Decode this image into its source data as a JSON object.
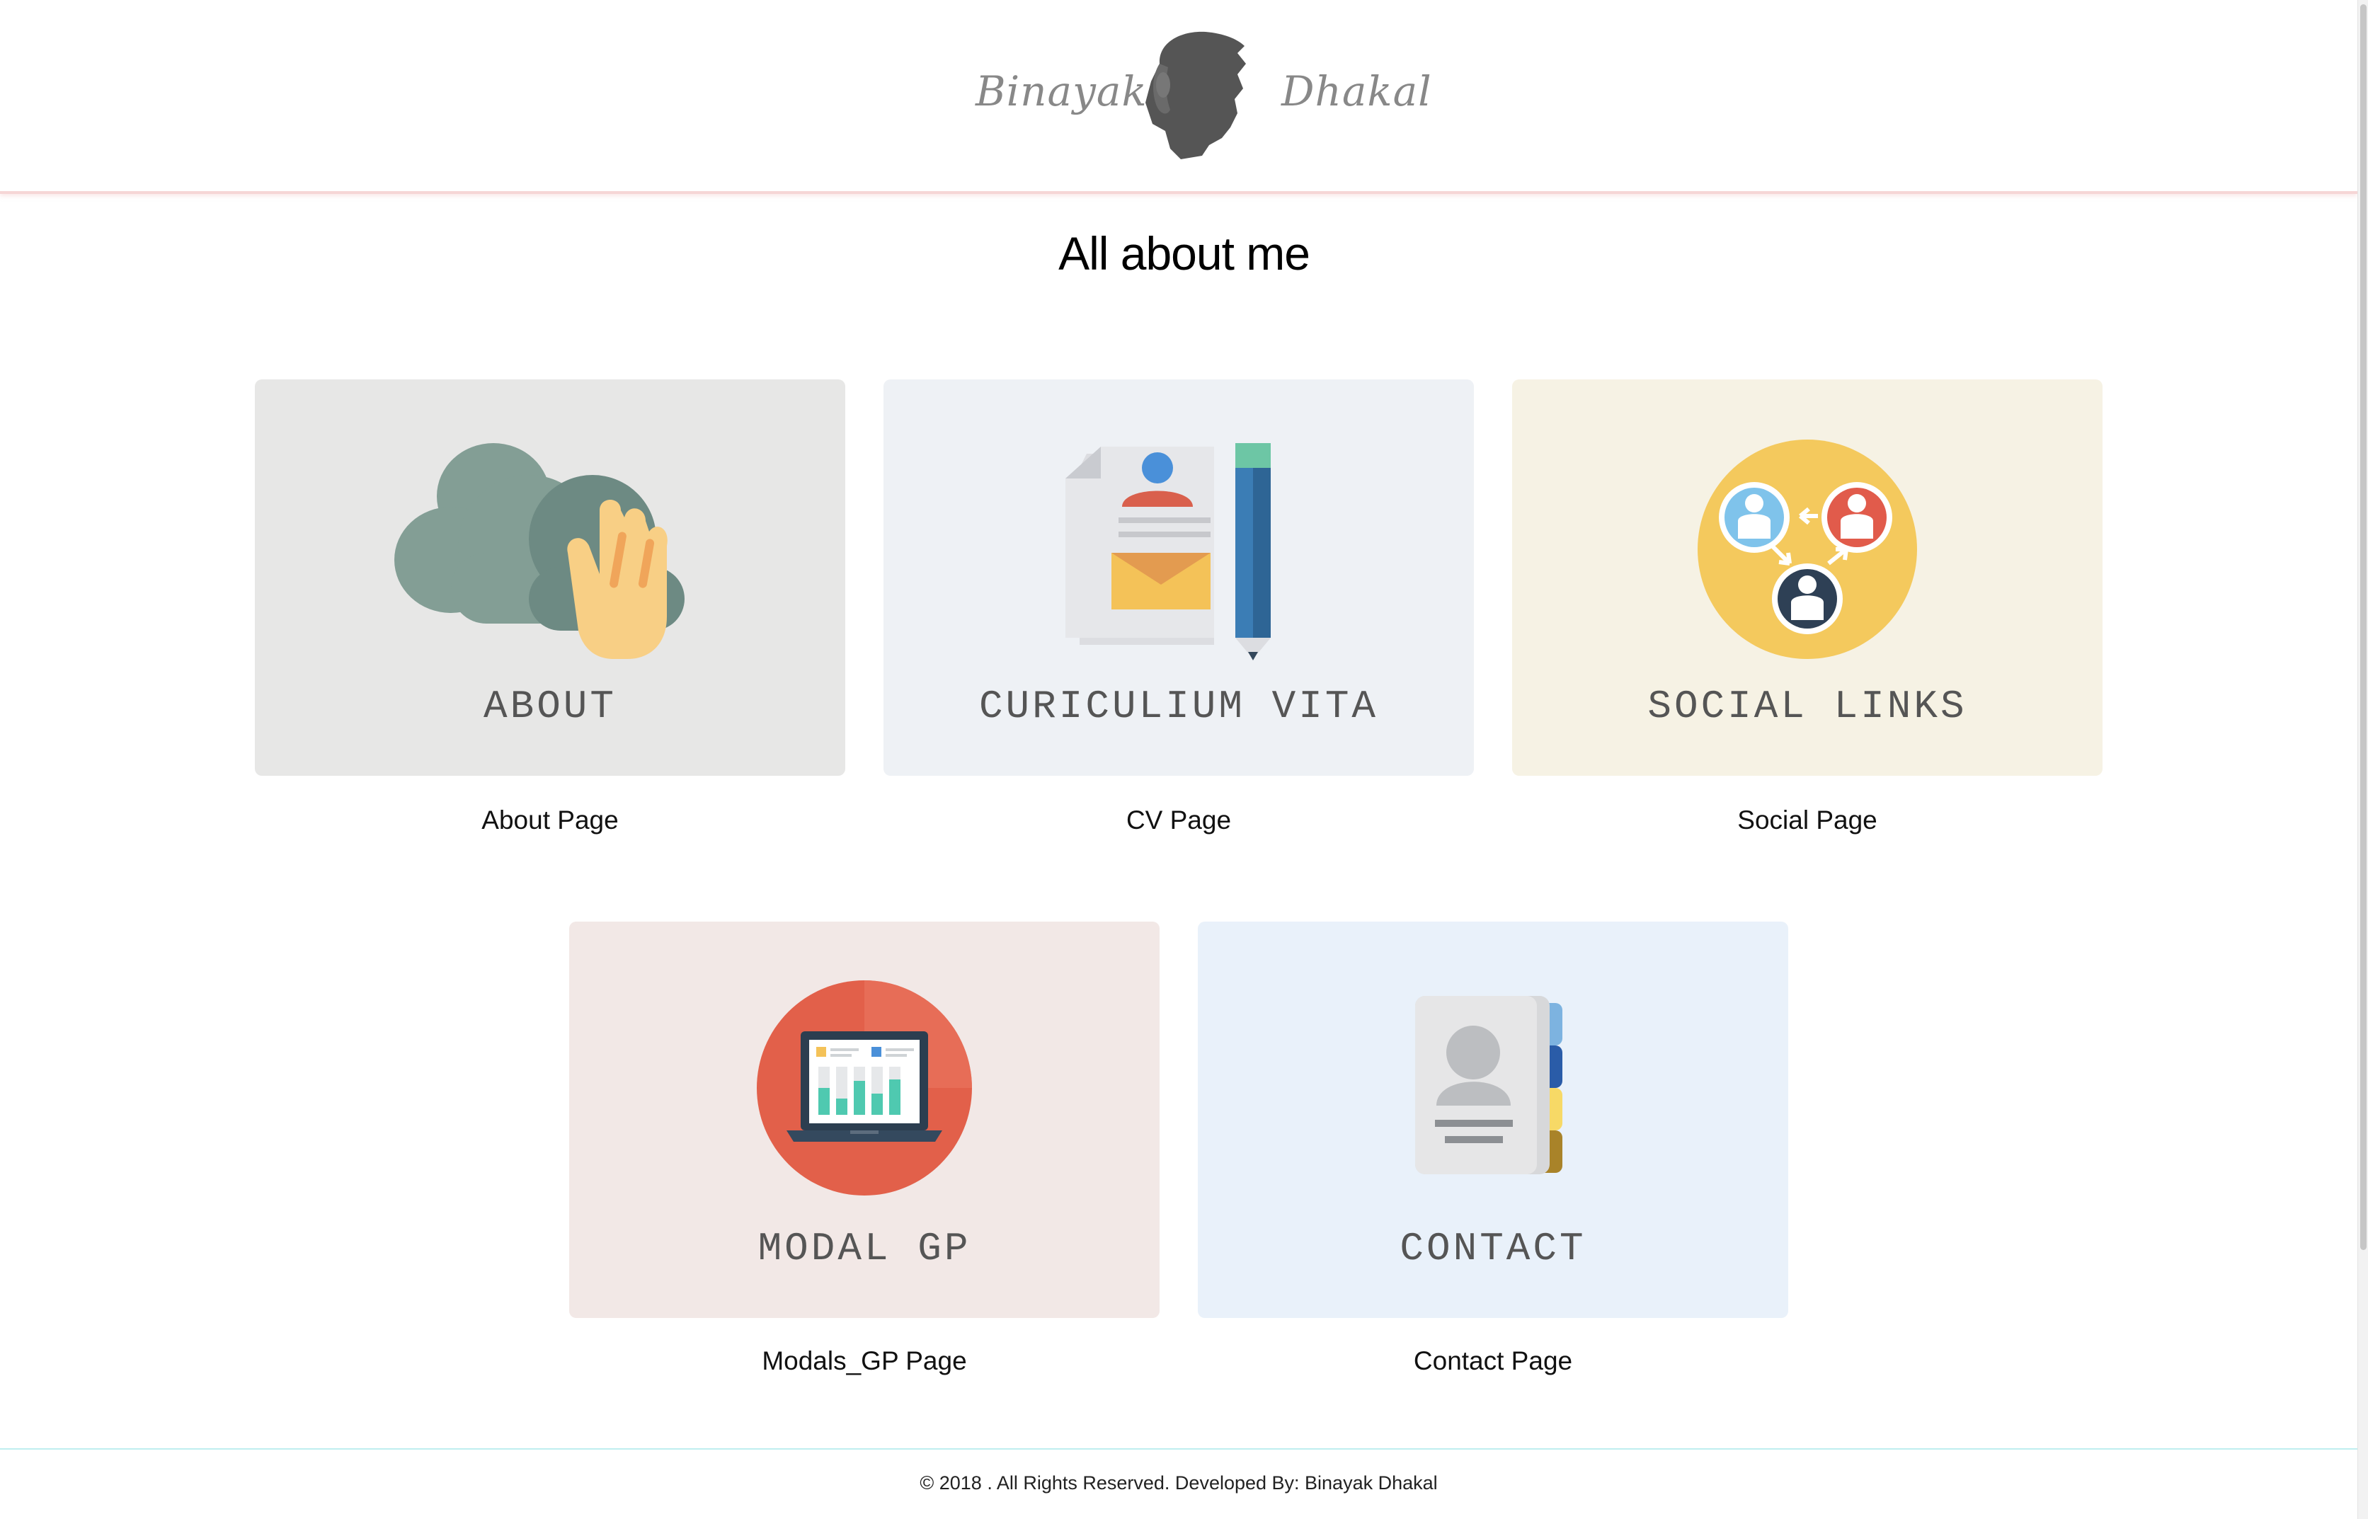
{
  "header": {
    "logo_first": "Binayak",
    "logo_last": "Dhakal"
  },
  "page_title": "All about me",
  "cards": [
    {
      "label": "ABOUT",
      "caption": "About Page",
      "bg": "#e7e7e6",
      "icon": "cloud-hand-icon"
    },
    {
      "label": "CURICULIUM VITA",
      "caption": "CV Page",
      "bg": "#eef1f5",
      "icon": "resume-pencil-icon"
    },
    {
      "label": "SOCIAL LINKS",
      "caption": "Social Page",
      "bg": "#f6f2e4",
      "icon": "social-network-icon"
    },
    {
      "label": "MODAL GP",
      "caption": "Modals_GP Page",
      "bg": "#f2e8e6",
      "icon": "laptop-chart-icon"
    },
    {
      "label": "CONTACT",
      "caption": "Contact Page",
      "bg": "#e9f1fa",
      "icon": "address-book-icon"
    }
  ],
  "footer": {
    "text": "© 2018 . All Rights Reserved. Developed By: Binayak Dhakal"
  }
}
